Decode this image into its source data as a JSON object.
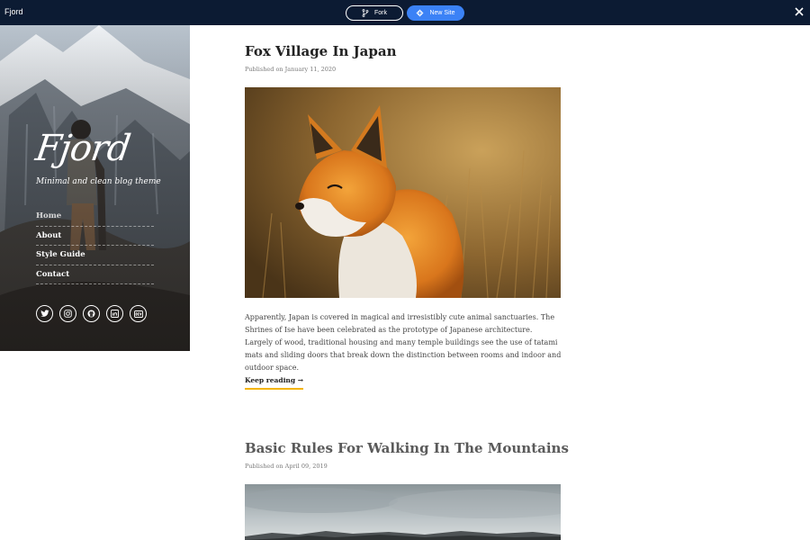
{
  "topbar": {
    "app_name": "Fjord",
    "fork_label": "Fork",
    "new_site_label": "New Site"
  },
  "sidebar": {
    "logo": "Fjord",
    "tagline": "Minimal and clean blog theme",
    "nav": [
      {
        "label": "Home",
        "active": true
      },
      {
        "label": "About"
      },
      {
        "label": "Style Guide"
      },
      {
        "label": "Contact"
      }
    ],
    "socials": [
      "twitter-icon",
      "instagram-icon",
      "github-icon",
      "linkedin-icon",
      "devto-icon"
    ]
  },
  "posts": [
    {
      "title": "Fox Village In Japan",
      "date": "Published on January 11, 2020",
      "excerpt": "Apparently, Japan is covered in magical and irresistibly cute animal sanctuaries. The Shrines of Ise have been celebrated as the prototype of Japanese architecture. Largely of wood, traditional housing and many temple buildings see the use of tatami mats and sliding doors that break down the distinction between rooms and indoor and outdoor space.",
      "read_more": "Keep reading →"
    },
    {
      "title": "Basic Rules For Walking In The Mountains",
      "date": "Published on April 09, 2019"
    }
  ],
  "colors": {
    "topbar_bg": "#0c1b33",
    "new_site_button": "#3b82f6",
    "link_underline": "#f4b400"
  }
}
